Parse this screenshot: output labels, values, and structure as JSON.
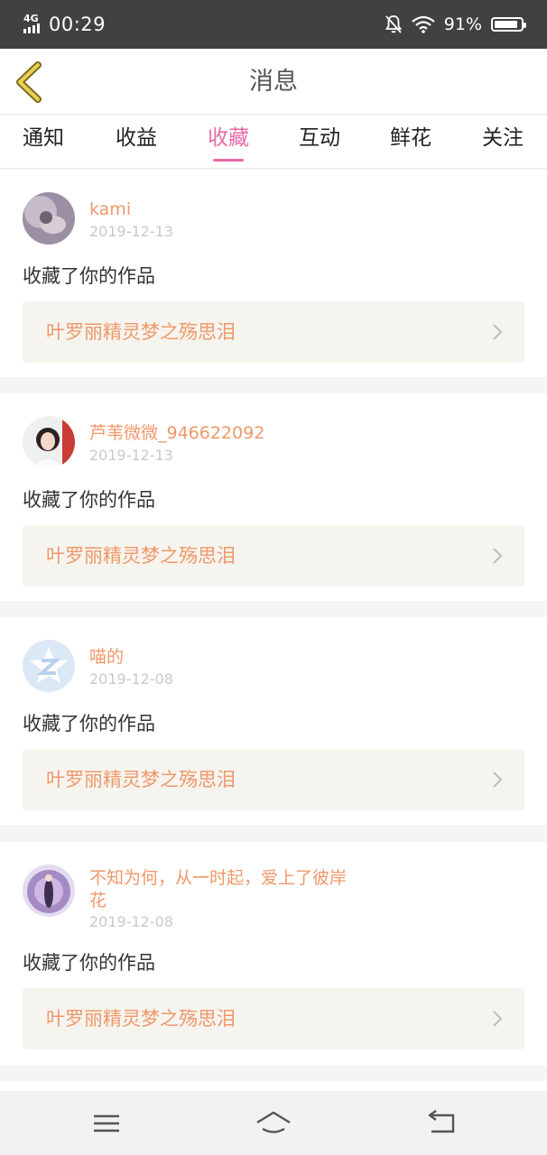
{
  "status_bar": {
    "network": "4G",
    "time": "00:29",
    "battery_text": "91%",
    "battery_level": 0.91
  },
  "nav": {
    "title": "消息",
    "back_icon": "back-chevron-icon",
    "accent_color": "#e0c64a"
  },
  "tabs": [
    {
      "label": "通知",
      "active": false
    },
    {
      "label": "收益",
      "active": false
    },
    {
      "label": "收藏",
      "active": true
    },
    {
      "label": "互动",
      "active": false
    },
    {
      "label": "鲜花",
      "active": false
    },
    {
      "label": "关注",
      "active": false
    }
  ],
  "colors": {
    "active_tab": "#e86aa6",
    "username": "#f0986a",
    "work_title": "#f0986a",
    "date": "#c9c9c9"
  },
  "messages": [
    {
      "username": "kami",
      "date": "2019-12-13",
      "action": "收藏了你的作品",
      "work_title": "叶罗丽精灵梦之殇思泪"
    },
    {
      "username": "芦苇微微_946622092",
      "date": "2019-12-13",
      "action": "收藏了你的作品",
      "work_title": "叶罗丽精灵梦之殇思泪"
    },
    {
      "username": "喵的",
      "date": "2019-12-08",
      "action": "收藏了你的作品",
      "work_title": "叶罗丽精灵梦之殇思泪"
    },
    {
      "username": "不知为何，从一时起，爱上了彼岸花",
      "date": "2019-12-08",
      "action": "收藏了你的作品",
      "work_title": "叶罗丽精灵梦之殇思泪"
    }
  ],
  "bottom_nav": {
    "menu_icon": "menu-icon",
    "home_icon": "home-icon",
    "back_icon": "return-icon"
  }
}
